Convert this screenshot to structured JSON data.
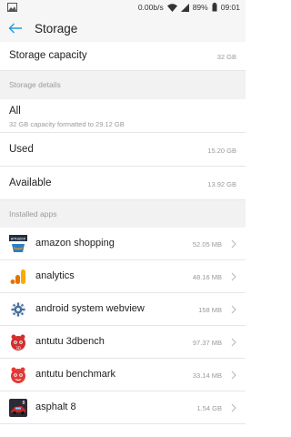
{
  "status_bar": {
    "speed": "0.00b/s",
    "battery": "89%",
    "time": "09:01"
  },
  "header": {
    "title": "Storage"
  },
  "capacity": {
    "label": "Storage capacity",
    "value": "32 GB"
  },
  "details": {
    "header": "Storage details",
    "all_label": "All",
    "all_sub": "32 GB capacity formatted to 29.12 GB",
    "used_label": "Used",
    "used_value": "15.20 GB",
    "available_label": "Available",
    "available_value": "13.92 GB"
  },
  "apps": {
    "header": "Installed apps",
    "items": [
      {
        "name": "amazon shopping",
        "size": "52.05 MB",
        "icon": "amazon-icon"
      },
      {
        "name": "analytics",
        "size": "48.16 MB",
        "icon": "analytics-icon"
      },
      {
        "name": "android system webview",
        "size": "158 MB",
        "icon": "webview-gear-icon"
      },
      {
        "name": "antutu 3dbench",
        "size": "97.37 MB",
        "icon": "antutu-3dbench-icon"
      },
      {
        "name": "antutu benchmark",
        "size": "33.14 MB",
        "icon": "antutu-benchmark-icon"
      },
      {
        "name": "asphalt 8",
        "size": "1.54 GB",
        "icon": "asphalt-icon"
      }
    ]
  },
  "colors": {
    "accent": "#1e9be0",
    "secondary_text": "#9a9a9a",
    "section_bg": "#f2f2f2"
  }
}
